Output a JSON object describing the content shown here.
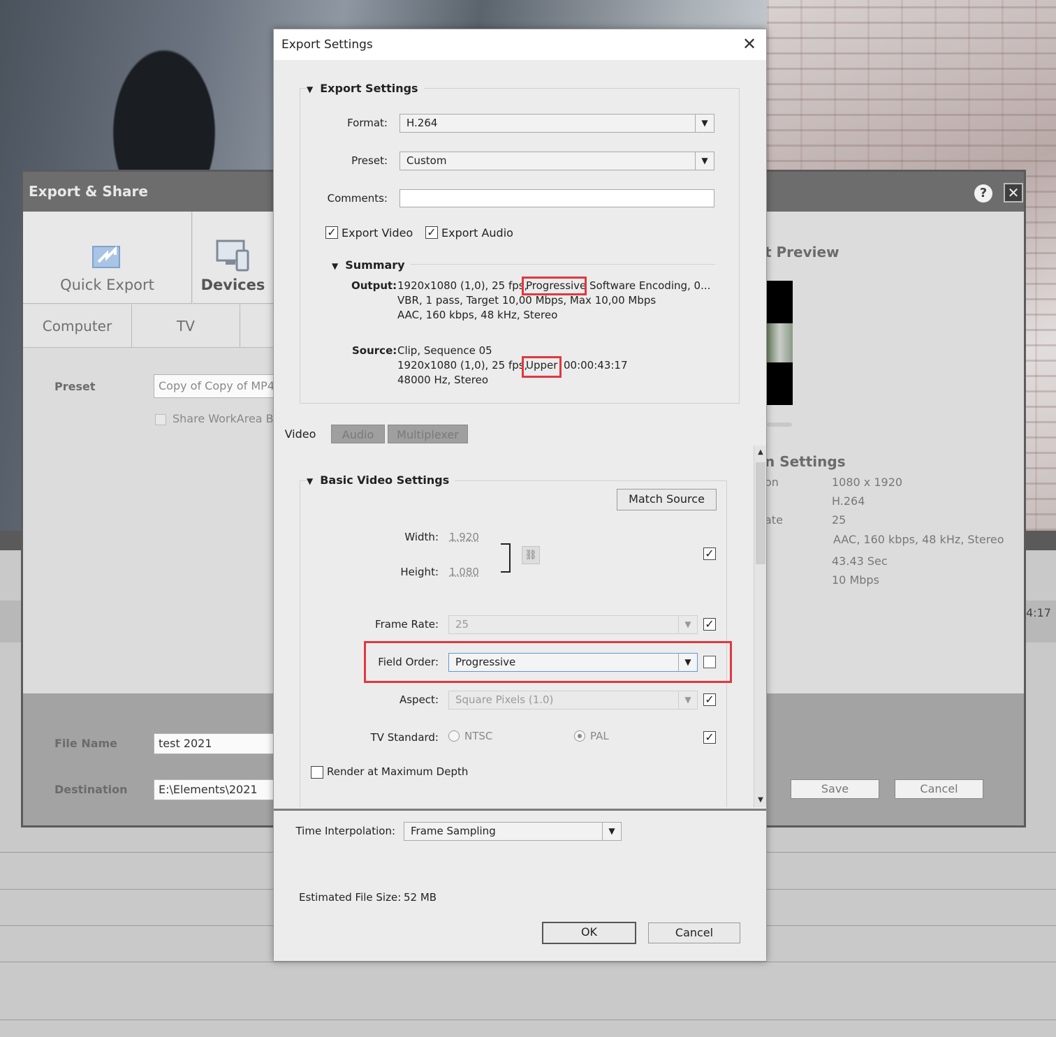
{
  "export_share": {
    "title": "Export & Share",
    "tiles": {
      "quick_export": "Quick Export",
      "devices": "Devices",
      "computer": "Computer",
      "tv": "TV"
    },
    "preset_label": "Preset",
    "preset_value": "Copy of Copy of MP4 -",
    "share_workarea_label": "Share WorkArea Ba",
    "preview_title": "t Preview",
    "settings_title": "n Settings",
    "info_labels": [
      "on",
      "ate"
    ],
    "info_values": [
      "1080 x 1920",
      "H.264",
      "25",
      "AAC, 160 kbps, 48 kHz, Stereo",
      "43.43 Sec",
      "10 Mbps"
    ],
    "timecode_fragment": "4:17",
    "file_name_label": "File Name",
    "file_name_value": "test 2021",
    "destination_label": "Destination",
    "destination_value": "E:\\Elements\\2021",
    "save_label": "Save",
    "cancel_label": "Cancel"
  },
  "dialog": {
    "title": "Export Settings",
    "section_title": "Export Settings",
    "format_label": "Format:",
    "format_value": "H.264",
    "preset_label": "Preset:",
    "preset_value": "Custom",
    "comments_label": "Comments:",
    "comments_value": "",
    "export_video_label": "Export Video",
    "export_video_checked": true,
    "export_audio_label": "Export Audio",
    "export_audio_checked": true,
    "summary_title": "Summary",
    "output_label": "Output:",
    "output_line1_a": "1920x1080 (1,0), 25 fps,",
    "output_line1_hl": "Progressive",
    "output_line1_b": "Software Encoding, 0...",
    "output_line2": "VBR, 1 pass, Target 10,00 Mbps, Max 10,00 Mbps",
    "output_line3": "AAC, 160 kbps, 48 kHz, Stereo",
    "source_label": "Source:",
    "source_line1": "Clip, Sequence 05",
    "source_line2_a": "1920x1080 (1,0), 25 fps,",
    "source_line2_hl": "Upper",
    "source_line2_b": "00:00:43:17",
    "source_line3": "48000 Hz, Stereo",
    "tabs": [
      "Video",
      "Audio",
      "Multiplexer"
    ],
    "basic_title": "Basic Video Settings",
    "match_source_label": "Match Source",
    "width_label": "Width:",
    "width_value": "1.920",
    "height_label": "Height:",
    "height_value": "1.080",
    "frame_rate_label": "Frame Rate:",
    "frame_rate_value": "25",
    "field_order_label": "Field Order:",
    "field_order_value": "Progressive",
    "aspect_label": "Aspect:",
    "aspect_value": "Square Pixels (1.0)",
    "tv_standard_label": "TV Standard:",
    "ntsc_label": "NTSC",
    "pal_label": "PAL",
    "render_max_depth_label": "Render at Maximum Depth",
    "time_interp_label": "Time Interpolation:",
    "time_interp_value": "Frame Sampling",
    "est_size_label": "Estimated File Size:",
    "est_size_value": "52 MB",
    "ok_label": "OK",
    "cancel_label": "Cancel"
  },
  "icons": {
    "checkmark": "✓",
    "dropdown_arrow": "▼",
    "triangle": "▼",
    "close": "✕",
    "help": "?",
    "link": "⛓"
  }
}
